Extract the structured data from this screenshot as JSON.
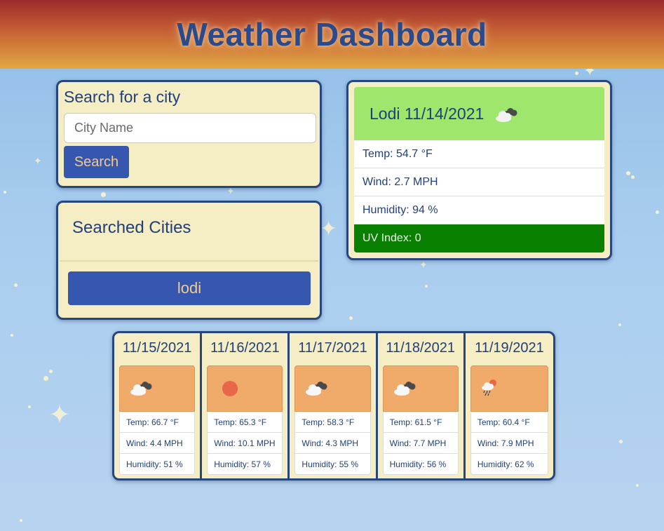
{
  "header": {
    "title": "Weather Dashboard"
  },
  "search": {
    "label": "Search for a city",
    "placeholder": "City Name",
    "value": "",
    "button_label": "Search"
  },
  "history": {
    "title": "Searched Cities",
    "items": [
      "lodi"
    ]
  },
  "current": {
    "title": "Lodi 11/14/2021",
    "icon": "broken-clouds-icon",
    "temp": "Temp: 54.7 °F",
    "wind": "Wind: 2.7 MPH",
    "humidity": "Humidity: 94 %",
    "uv": "UV Index: 0",
    "uv_color": "#0a8000",
    "header_color": "#9fe66d"
  },
  "forecast": [
    {
      "date": "11/15/2021",
      "icon": "broken-clouds-icon",
      "temp": "Temp: 66.7 °F",
      "wind": "Wind: 4.4 MPH",
      "humidity": "Humidity: 51 %"
    },
    {
      "date": "11/16/2021",
      "icon": "sun-icon",
      "temp": "Temp: 65.3 °F",
      "wind": "Wind: 10.1 MPH",
      "humidity": "Humidity: 57 %"
    },
    {
      "date": "11/17/2021",
      "icon": "broken-clouds-icon",
      "temp": "Temp: 58.3 °F",
      "wind": "Wind: 4.3 MPH",
      "humidity": "Humidity: 55 %"
    },
    {
      "date": "11/18/2021",
      "icon": "broken-clouds-icon",
      "temp": "Temp: 61.5 °F",
      "wind": "Wind: 7.7 MPH",
      "humidity": "Humidity: 56 %"
    },
    {
      "date": "11/19/2021",
      "icon": "rain-sun-icon",
      "temp": "Temp: 60.4 °F",
      "wind": "Wind: 7.9 MPH",
      "humidity": "Humidity: 62 %"
    }
  ],
  "colors": {
    "header_gradient_top": "#9b2a2d",
    "header_gradient_bottom": "#e3a744",
    "panel_bg": "#f5edc3",
    "panel_border": "#26467d",
    "button_bg": "#3557b0",
    "button_text": "#f3c98d",
    "forecast_icon_bg": "#f0aa6a"
  }
}
